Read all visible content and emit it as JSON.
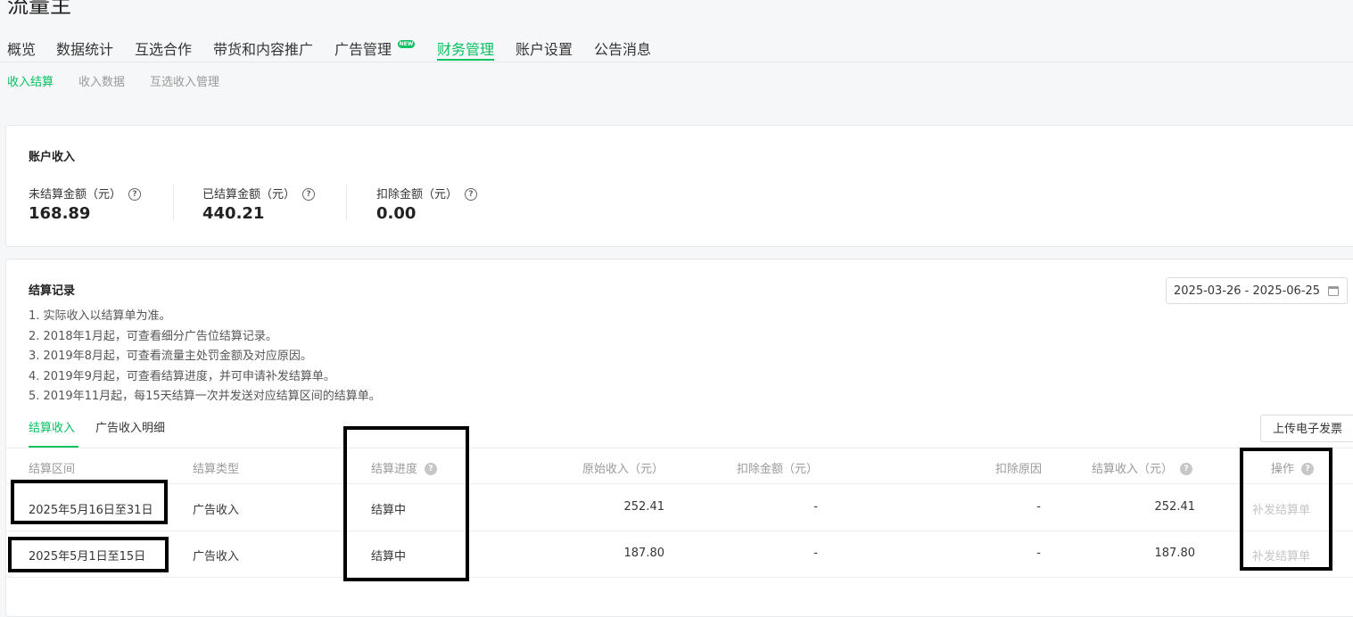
{
  "app": {
    "title": "流量主"
  },
  "nav": {
    "items": [
      {
        "label": "概览"
      },
      {
        "label": "数据统计"
      },
      {
        "label": "互选合作"
      },
      {
        "label": "带货和内容推广"
      },
      {
        "label": "广告管理",
        "badge": "NEW"
      },
      {
        "label": "财务管理",
        "active": true
      },
      {
        "label": "账户设置"
      },
      {
        "label": "公告消息"
      }
    ]
  },
  "subnav": {
    "items": [
      {
        "label": "收入结算",
        "active": true
      },
      {
        "label": "收入数据"
      },
      {
        "label": "互选收入管理"
      }
    ]
  },
  "income": {
    "title": "账户收入",
    "stats": [
      {
        "label": "未结算金额（元）",
        "value": "168.89"
      },
      {
        "label": "已结算金额（元）",
        "value": "440.21"
      },
      {
        "label": "扣除金额（元）",
        "value": "0.00"
      }
    ]
  },
  "records": {
    "title": "结算记录",
    "date_range": "2025-03-26 - 2025-06-25",
    "notes": [
      "1. 实际收入以结算单为准。",
      "2. 2018年1月起，可查看细分广告位结算记录。",
      "3. 2019年8月起，可查看流量主处罚金额及对应原因。",
      "4. 2019年9月起，可查看结算进度，并可申请补发结算单。",
      "5. 2019年11月起，每15天结算一次并发送对应结算区间的结算单。"
    ],
    "tabs": [
      {
        "label": "结算收入",
        "active": true
      },
      {
        "label": "广告收入明细"
      }
    ],
    "upload_label": "上传电子发票",
    "table": {
      "headers": {
        "period": "结算区间",
        "type": "结算类型",
        "progress": "结算进度",
        "original": "原始收入（元）",
        "deduct": "扣除金额（元）",
        "reason": "扣除原因",
        "settled": "结算收入（元）",
        "action": "操作"
      },
      "rows": [
        {
          "period": "2025年5月16日至31日",
          "type": "广告收入",
          "progress": "结算中",
          "original": "252.41",
          "deduct": "-",
          "reason": "-",
          "settled": "252.41",
          "action": "补发结算单"
        },
        {
          "period": "2025年5月1日至15日",
          "type": "广告收入",
          "progress": "结算中",
          "original": "187.80",
          "deduct": "-",
          "reason": "-",
          "settled": "187.80",
          "action": "补发结算单"
        }
      ]
    }
  },
  "colors": {
    "accent": "#07c160",
    "highlight_box": "#000000"
  }
}
